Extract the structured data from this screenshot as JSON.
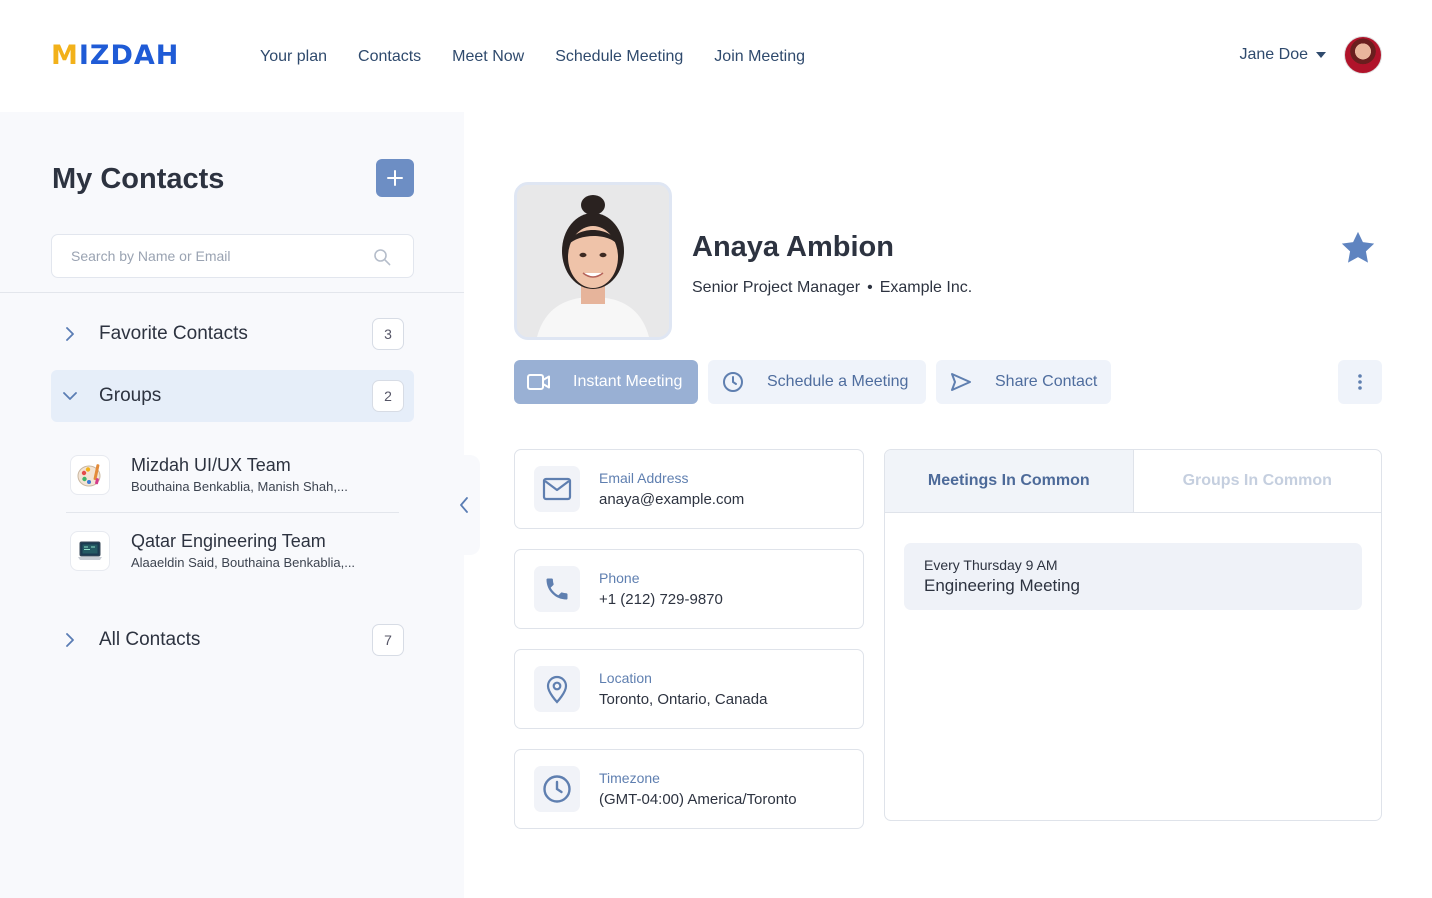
{
  "header": {
    "logo": "MIZDAH",
    "nav": [
      "Your plan",
      "Contacts",
      "Meet Now",
      "Schedule Meeting",
      "Join Meeting"
    ],
    "user_name": "Jane Doe"
  },
  "sidebar": {
    "title": "My Contacts",
    "search_placeholder": "Search by Name or Email",
    "favorites": {
      "label": "Favorite Contacts",
      "count": "3"
    },
    "groups": {
      "label": "Groups",
      "count": "2"
    },
    "group_items": [
      {
        "name": "Mizdah UI/UX Team",
        "members": "Bouthaina Benkablia, Manish Shah,..."
      },
      {
        "name": "Qatar Engineering Team",
        "members": "Alaaeldin Said, Bouthaina Benkablia,..."
      }
    ],
    "all_contacts": {
      "label": "All Contacts",
      "count": "7"
    }
  },
  "profile": {
    "name": "Anaya Ambion",
    "title": "Senior Project Manager",
    "separator": "•",
    "company": "Example Inc."
  },
  "actions": {
    "instant": "Instant Meeting",
    "schedule": "Schedule a Meeting",
    "share": "Share Contact"
  },
  "info": {
    "email": {
      "label": "Email Address",
      "value": "anaya@example.com"
    },
    "phone": {
      "label": "Phone",
      "value": "+1 (212) 729-9870"
    },
    "location": {
      "label": "Location",
      "value": "Toronto, Ontario, Canada"
    },
    "timezone": {
      "label": "Timezone",
      "value": "(GMT-04:00) America/Toronto"
    }
  },
  "common": {
    "tabs": [
      "Meetings In Common",
      "Groups In Common"
    ],
    "meetings": [
      {
        "time": "Every Thursday 9 AM",
        "title": "Engineering Meeting"
      }
    ]
  },
  "colors": {
    "brand_blue": "#1f5bd6",
    "brand_yellow": "#f2b11a",
    "accent": "#6d8ec4",
    "primary_button": "#99b0d4"
  }
}
